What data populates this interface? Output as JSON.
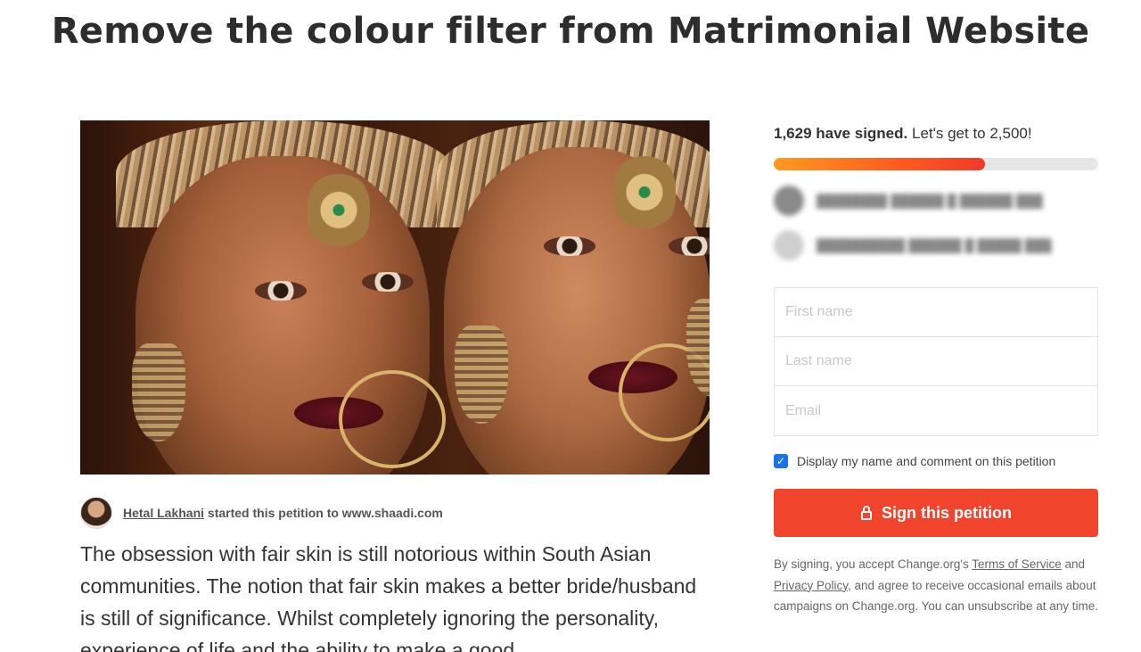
{
  "page": {
    "title": "Remove the colour filter from Matrimonial Website"
  },
  "author": {
    "name": "Hetal Lakhani",
    "action": "started this petition to www.shaadi.com"
  },
  "description": "The obsession with fair skin is still notorious within South Asian communities. The notion that fair skin makes a better bride/husband is still of significance. Whilst completely ignoring the personality, experience of life and the ability to make a good",
  "signatures": {
    "signed_count": "1,629 have signed.",
    "goal_text": "Let's get to 2,500!",
    "progress": 0.652
  },
  "recent_signers": [
    {
      "text": ""
    },
    {
      "text": ""
    }
  ],
  "form": {
    "first_name_placeholder": "First name",
    "last_name_placeholder": "Last name",
    "email_placeholder": "Email",
    "display_label": "Display my name and comment on this petition",
    "display_checked": true,
    "sign_button_label": "Sign this petition"
  },
  "legal": {
    "prefix": "By signing, you accept Change.org's",
    "terms_link": "Terms of Service",
    "and": "and",
    "privacy_link": "Privacy Policy",
    "suffix": ", and agree to receive occasional emails about campaigns on Change.org. You can unsubscribe at any time."
  },
  "colors": {
    "accent": "#f0452c",
    "progress_start": "#ff9a1f",
    "progress_end": "#f03a28",
    "checkbox": "#1a73e8"
  }
}
